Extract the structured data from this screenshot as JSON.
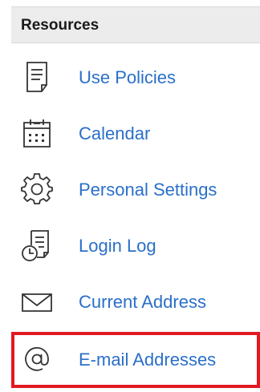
{
  "resources": {
    "title": "Resources",
    "items": [
      {
        "label": "Use Policies",
        "icon": "document-icon"
      },
      {
        "label": "Calendar",
        "icon": "calendar-icon"
      },
      {
        "label": "Personal Settings",
        "icon": "gear-icon"
      },
      {
        "label": "Login Log",
        "icon": "document-clock-icon"
      },
      {
        "label": "Current Address",
        "icon": "envelope-icon"
      },
      {
        "label": "E-mail Addresses",
        "icon": "at-sign-icon"
      }
    ],
    "selected_index": 5,
    "colors": {
      "link": "#2a6fc9",
      "header_bg": "#ececec",
      "highlight": "#e11922"
    }
  }
}
